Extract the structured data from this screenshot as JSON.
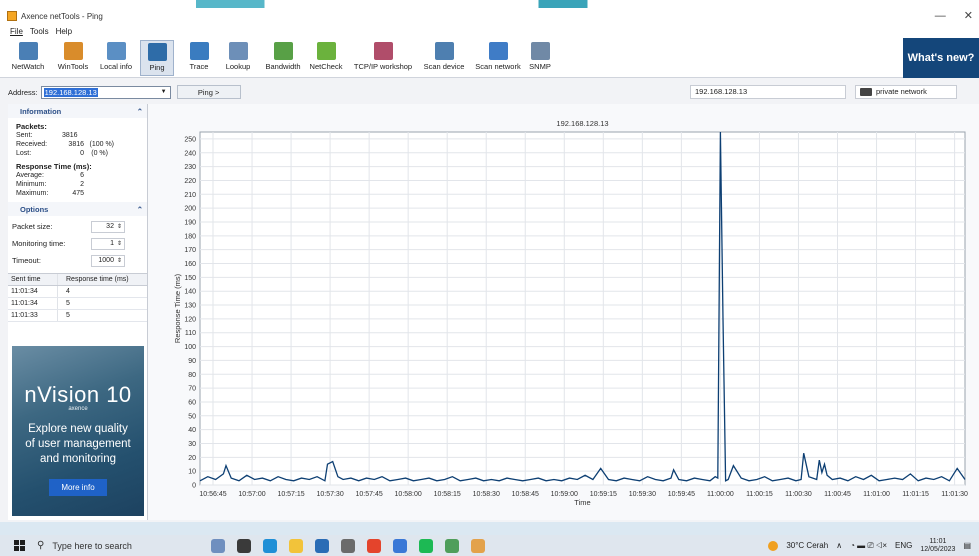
{
  "window": {
    "title": "Axence netTools - Ping",
    "minimize": "—",
    "close": "✕"
  },
  "menu": [
    "File",
    "Tools",
    "Help"
  ],
  "toolbar": {
    "items": [
      {
        "label": "NetWatch",
        "icon": "netwatch-icon",
        "color": "#4a7fb5"
      },
      {
        "label": "WinTools",
        "icon": "wintools-icon",
        "color": "#d98c2b"
      },
      {
        "label": "Local info",
        "icon": "local-info-icon",
        "color": "#5b8fc4"
      },
      {
        "label": "Ping",
        "icon": "ping-icon",
        "color": "#2e6ca8"
      },
      {
        "label": "Trace",
        "icon": "trace-icon",
        "color": "#3a7cc0"
      },
      {
        "label": "Lookup",
        "icon": "lookup-icon",
        "color": "#6d8fb8"
      },
      {
        "label": "Bandwidth",
        "icon": "bandwidth-icon",
        "color": "#58a046"
      },
      {
        "label": "NetCheck",
        "icon": "netcheck-icon",
        "color": "#6bb23d"
      },
      {
        "label": "TCP/IP workshop",
        "icon": "tcpip-workshop-icon",
        "color": "#b04d6a"
      },
      {
        "label": "Scan device",
        "icon": "scan-device-icon",
        "color": "#4e7fb0"
      },
      {
        "label": "Scan network",
        "icon": "scan-network-icon",
        "color": "#3f7cc6"
      },
      {
        "label": "SNMP",
        "icon": "snmp-icon",
        "color": "#7089a6"
      }
    ],
    "whats_new": "What's new?"
  },
  "address": {
    "label": "Address:",
    "value": "192.168.128.13",
    "ping_button": "Ping >",
    "resolved_ip": "192.168.128.13",
    "network": "private network"
  },
  "info": {
    "header": "Information",
    "packets_title": "Packets:",
    "sent_label": "Sent:",
    "sent": "3816",
    "received_label": "Received:",
    "received": "3816",
    "received_pct": "(100 %)",
    "lost_label": "Lost:",
    "lost": "0",
    "lost_pct": "(0 %)",
    "rt_title": "Response Time (ms):",
    "avg_label": "Average:",
    "avg": "6",
    "min_label": "Minimum:",
    "min": "2",
    "max_label": "Maximum:",
    "max": "475"
  },
  "options": {
    "header": "Options",
    "packet_size_label": "Packet size:",
    "packet_size": "32",
    "monitoring_label": "Monitoring time:",
    "monitoring": "1",
    "timeout_label": "Timeout:",
    "timeout": "1000"
  },
  "table": {
    "headers": [
      "Sent time",
      "Response time (ms)"
    ],
    "rows": [
      {
        "time": "11:01:34",
        "rt": "4"
      },
      {
        "time": "11:01:34",
        "rt": "5"
      },
      {
        "time": "11:01:33",
        "rt": "5"
      }
    ]
  },
  "ad": {
    "logo": "nVision 10",
    "brand": "axence",
    "text_line1": "Explore new quality",
    "text_line2": "of user management",
    "text_line3": "and monitoring",
    "button": "More info"
  },
  "chart_data": {
    "type": "line",
    "title": "192.168.128.13",
    "xlabel": "Time",
    "ylabel": "Response Time (ms)",
    "ylim": [
      0,
      255
    ],
    "yticks": [
      0,
      10,
      20,
      30,
      40,
      50,
      60,
      70,
      80,
      90,
      100,
      110,
      120,
      130,
      140,
      150,
      160,
      170,
      180,
      190,
      200,
      210,
      220,
      230,
      240,
      250
    ],
    "xticks": [
      "10:56:45",
      "10:57:00",
      "10:57:15",
      "10:57:30",
      "10:57:45",
      "10:58:00",
      "10:58:15",
      "10:58:30",
      "10:58:45",
      "10:59:00",
      "10:59:15",
      "10:59:30",
      "10:59:45",
      "11:00:00",
      "11:00:15",
      "11:00:30",
      "11:00:45",
      "11:01:00",
      "11:01:15",
      "11:01:30"
    ],
    "x_start": "10:56:40",
    "x_end": "11:01:34",
    "grid": true,
    "color": "#0d3f73",
    "series": [
      {
        "x": [
          "10:56:40",
          "10:56:43",
          "10:56:46",
          "10:56:49",
          "10:56:50",
          "10:56:52",
          "10:56:55",
          "10:56:58",
          "10:57:01",
          "10:57:04",
          "10:57:07",
          "10:57:10",
          "10:57:13",
          "10:57:16",
          "10:57:19",
          "10:57:22",
          "10:57:25",
          "10:57:28",
          "10:57:29",
          "10:57:31",
          "10:57:33",
          "10:57:35",
          "10:57:38",
          "10:57:41",
          "10:57:44",
          "10:57:47",
          "10:57:50",
          "10:57:53",
          "10:57:56",
          "10:57:59",
          "10:58:02",
          "10:58:05",
          "10:58:08",
          "10:58:11",
          "10:58:14",
          "10:58:17",
          "10:58:20",
          "10:58:23",
          "10:58:26",
          "10:58:29",
          "10:58:32",
          "10:58:35",
          "10:58:38",
          "10:58:41",
          "10:58:44",
          "10:58:47",
          "10:58:50",
          "10:58:53",
          "10:58:56",
          "10:58:59",
          "10:59:02",
          "10:59:05",
          "10:59:08",
          "10:59:11",
          "10:59:14",
          "10:59:17",
          "10:59:20",
          "10:59:23",
          "10:59:26",
          "10:59:29",
          "10:59:32",
          "10:59:35",
          "10:59:38",
          "10:59:41",
          "10:59:42",
          "10:59:44",
          "10:59:47",
          "10:59:50",
          "10:59:53",
          "10:59:56",
          "10:59:58",
          "10:59:59",
          "11:00:00",
          "11:00:01",
          "11:00:02",
          "11:00:03",
          "11:00:05",
          "11:00:08",
          "11:00:11",
          "11:00:14",
          "11:00:17",
          "11:00:20",
          "11:00:23",
          "11:00:26",
          "11:00:29",
          "11:00:31",
          "11:00:32",
          "11:00:34",
          "11:00:37",
          "11:00:38",
          "11:00:39",
          "11:00:40",
          "11:00:41",
          "11:00:43",
          "11:00:46",
          "11:00:49",
          "11:00:52",
          "11:00:55",
          "11:00:58",
          "11:01:01",
          "11:01:04",
          "11:01:07",
          "11:01:10",
          "11:01:13",
          "11:01:16",
          "11:01:19",
          "11:01:22",
          "11:01:25",
          "11:01:28",
          "11:01:31",
          "11:01:34"
        ],
        "y": [
          3,
          6,
          4,
          8,
          14,
          5,
          3,
          7,
          4,
          5,
          3,
          6,
          4,
          3,
          5,
          4,
          6,
          3,
          15,
          17,
          6,
          4,
          5,
          3,
          5,
          4,
          6,
          3,
          4,
          5,
          3,
          4,
          5,
          3,
          4,
          6,
          3,
          4,
          5,
          3,
          4,
          3,
          5,
          4,
          3,
          4,
          5,
          3,
          4,
          3,
          5,
          4,
          7,
          4,
          12,
          4,
          3,
          5,
          4,
          3,
          6,
          4,
          3,
          5,
          11,
          4,
          3,
          5,
          4,
          3,
          6,
          5,
          255,
          120,
          3,
          4,
          14,
          5,
          3,
          4,
          6,
          3,
          4,
          5,
          3,
          4,
          23,
          6,
          4,
          18,
          9,
          15,
          7,
          4,
          5,
          3,
          6,
          4,
          7,
          3,
          4,
          5,
          4,
          8,
          3,
          5,
          4,
          6,
          3,
          12,
          4
        ]
      }
    ]
  },
  "taskbar": {
    "search_placeholder": "Type here to search",
    "weather": "30°C  Cerah",
    "lang": "ENG",
    "time": "11:01",
    "date": "12/05/2023",
    "apps": [
      {
        "icon": "widgets-icon",
        "color": "#6f8fbf"
      },
      {
        "icon": "task-view-icon",
        "color": "#3a3a3a"
      },
      {
        "icon": "edge-icon",
        "color": "#1f8fd6"
      },
      {
        "icon": "file-explorer-icon",
        "color": "#f2c33a"
      },
      {
        "icon": "mail-icon",
        "color": "#2a6cb5"
      },
      {
        "icon": "app-icon",
        "color": "#6b6b6b"
      },
      {
        "icon": "chrome-icon",
        "color": "#e4442c"
      },
      {
        "icon": "chrome-alt-icon",
        "color": "#3b78d6"
      },
      {
        "icon": "spotify-icon",
        "color": "#1db954"
      },
      {
        "icon": "chrome-profile-icon",
        "color": "#4f9e5b"
      },
      {
        "icon": "nettools-icon",
        "color": "#e3a24b"
      }
    ]
  }
}
